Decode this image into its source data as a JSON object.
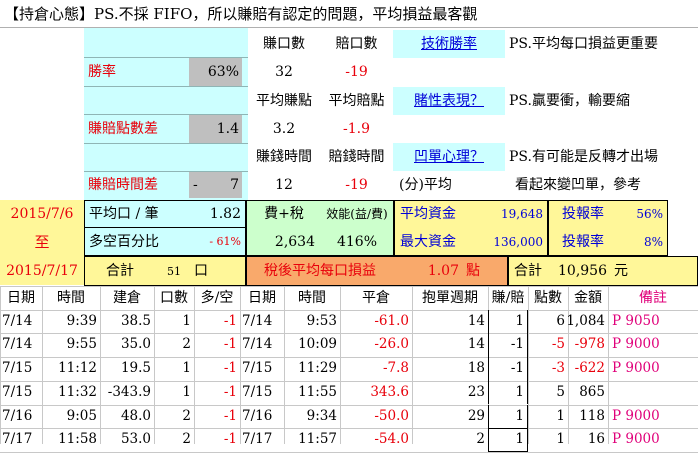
{
  "header": {
    "title": "【持倉心態】PS.不採 FIFO，所以賺賠有認定的問題，平均損益最客觀"
  },
  "stats": {
    "col_win_qty": "賺口數",
    "col_loss_qty": "賠口數",
    "win_rate_label": "勝率",
    "win_rate": "63%",
    "win_qty": "32",
    "loss_qty": "-19",
    "avg_win_label": "平均賺點",
    "avg_loss_label": "平均賠點",
    "diff_label": "賺賠點數差",
    "diff": "1.4",
    "avg_win": "3.2",
    "avg_loss": "-1.9",
    "win_time_label": "賺錢時間",
    "loss_time_label": "賠錢時間",
    "time_diff_label": "賺賠時間差",
    "time_sign": "-",
    "time_diff": "7",
    "win_time": "12",
    "loss_time": "-19",
    "avg_min_label": "(分)平均"
  },
  "links": {
    "win_rate_link": "技術勝率",
    "gambling_link": "賭性表現？",
    "dip_link": "凹單心理？"
  },
  "notes": {
    "n1": "PS.平均每口損益更重要",
    "n2": "PS.贏要衝，輸要縮",
    "n3": "PS.有可能是反轉才出場",
    "n4": "看起來變凹單，參考"
  },
  "summary": {
    "date_from": "2015/7/6",
    "date_to_label": "至",
    "date_to": "2015/7/17",
    "avg_per_trade_label": "平均口 / 筆",
    "avg_per_trade": "1.82",
    "long_short_label": "多空百分比",
    "long_short": "- 61%",
    "fee_tax_label": "費+稅",
    "fee_tax": "2,634",
    "efficiency_label": "效能(益/費)",
    "efficiency": "416%",
    "avg_capital_label": "平均資金",
    "avg_capital": "19,648",
    "max_capital_label": "最大資金",
    "max_capital": "136,000",
    "roi_label": "投報率",
    "roi": "56%",
    "roi2_label": "投報率",
    "roi2": "8%",
    "total_label": "合計",
    "total_qty": "51",
    "qty_unit": "口",
    "after_tax_label": "稅後平均每口損益",
    "after_tax_avg": "1.07",
    "point_unit": "點",
    "grand_total_label": "合計",
    "grand_total": "10,956",
    "currency_unit": "元"
  },
  "table": {
    "headers": [
      "日期",
      "時間",
      "建倉",
      "口數",
      "多/空",
      "日期",
      "時間",
      "平倉",
      "抱單週期",
      "賺/賠",
      "點數",
      "金額",
      "備註"
    ],
    "rows": [
      {
        "d1": "7/14",
        "t1": "9:39",
        "open": "38.5",
        "qty": "1",
        "dir": "-1",
        "d2": "7/14",
        "t2": "9:53",
        "close": "-61.0",
        "hold": "14",
        "wl": "1",
        "pts": "6",
        "amt": "1,084",
        "note": "P 9050"
      },
      {
        "d1": "7/14",
        "t1": "9:55",
        "open": "35.0",
        "qty": "2",
        "dir": "-1",
        "d2": "7/14",
        "t2": "10:09",
        "close": "-26.0",
        "hold": "14",
        "wl": "-1",
        "pts": "-5",
        "amt": "-978",
        "note": "P 9000"
      },
      {
        "d1": "7/15",
        "t1": "11:12",
        "open": "19.5",
        "qty": "1",
        "dir": "-1",
        "d2": "7/15",
        "t2": "11:29",
        "close": "-7.8",
        "hold": "18",
        "wl": "-1",
        "pts": "-3",
        "amt": "-622",
        "note": "P 9000"
      },
      {
        "d1": "7/15",
        "t1": "11:32",
        "open": "-343.9",
        "qty": "1",
        "dir": "-1",
        "d2": "7/15",
        "t2": "11:55",
        "close": "343.6",
        "hold": "23",
        "wl": "1",
        "pts": "5",
        "amt": "865",
        "note": ""
      },
      {
        "d1": "7/16",
        "t1": "9:05",
        "open": "48.0",
        "qty": "2",
        "dir": "-1",
        "d2": "7/16",
        "t2": "9:34",
        "close": "-50.0",
        "hold": "29",
        "wl": "1",
        "pts": "1",
        "amt": "118",
        "note": "P 9000"
      },
      {
        "d1": "7/17",
        "t1": "11:58",
        "open": "53.0",
        "qty": "2",
        "dir": "-1",
        "d2": "7/17",
        "t2": "11:57",
        "close": "-54.0",
        "hold": "2",
        "wl": "1",
        "pts": "1",
        "amt": "16",
        "note": "P 9000"
      }
    ]
  },
  "colors": {
    "header_cyan": "#ccffff",
    "date_yellow": "#fff799",
    "after_tax_orange": "#f9a96b",
    "fee_green": "#ccffcc",
    "remarks_pink": "#e0007a",
    "negative_red": "#e8000b",
    "link_blue": "#0000d8"
  }
}
